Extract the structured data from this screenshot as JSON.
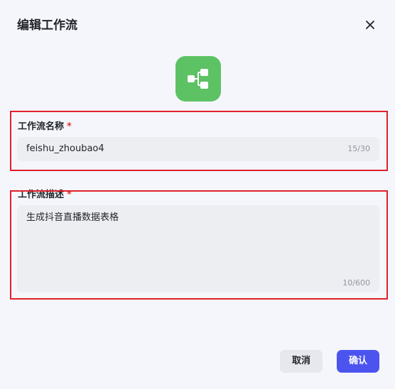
{
  "dialog": {
    "title": "编辑工作流",
    "icon": "workflow-branch-icon",
    "accent_color": "#5dc264"
  },
  "name_field": {
    "label": "工作流名称",
    "required_mark": "*",
    "value": "feishu_zhoubao4",
    "counter": "15/30"
  },
  "description_field": {
    "label": "工作流描述",
    "required_mark": "*",
    "value": "生成抖音直播数据表格",
    "counter": "10/600"
  },
  "buttons": {
    "cancel_label": "取消",
    "confirm_label": "确认",
    "confirm_color": "#4c54f0"
  },
  "highlight_color": "#e0202b"
}
